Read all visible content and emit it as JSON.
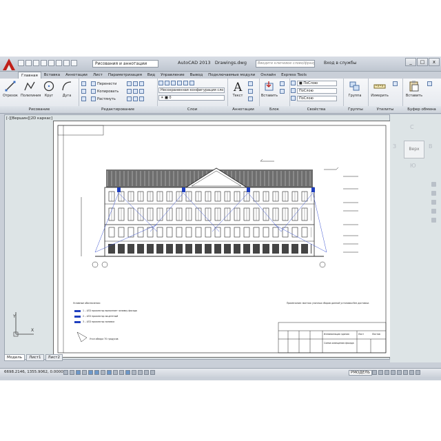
{
  "app": {
    "title": "AutoCAD 2013",
    "file": "Drawings.dwg",
    "workspace": "Рисования и аннотации",
    "search_placeholder": "Введите ключевое слово/фразу",
    "signin": "Вход в службы",
    "window_controls": [
      "_",
      "□",
      "x"
    ]
  },
  "ribbon": {
    "tabs": [
      "Главная",
      "Вставка",
      "Аннотации",
      "Лист",
      "Параметризация",
      "Вид",
      "Управление",
      "Вывод",
      "Подключаемые модули",
      "Онлайн",
      "Express Tools"
    ],
    "active_tab": "Главная",
    "draw": {
      "title": "Рисование",
      "tools": [
        "Отрезок",
        "Полилиния",
        "Круг",
        "Дуга"
      ]
    },
    "modify": {
      "title": "Редактирование",
      "tools": [
        "Перенести",
        "Копировать",
        "Растянуть"
      ]
    },
    "layers": {
      "title": "Слои",
      "layer_state": "Несохраненная конфигурация сло",
      "current_layer": "0"
    },
    "annotation": {
      "title": "Аннотации",
      "text": "Текст"
    },
    "block": {
      "title": "Блок",
      "insert": "Вставить"
    },
    "properties": {
      "title": "Свойства",
      "color": "ПоСлою",
      "linetype": "ПоСлою",
      "lineweight": "ПоСлою"
    },
    "groups": {
      "title": "Группы",
      "group": "Группа"
    },
    "utilities": {
      "title": "Утилиты",
      "measure": "Измерить"
    },
    "clipboard": {
      "title": "Буфер обмена",
      "paste": "Вставить"
    }
  },
  "viewport": {
    "label": "[-][Вершин][2D каркас]"
  },
  "viewcube": {
    "top": "Верх",
    "north": "С",
    "east": "В",
    "south": "Ю",
    "west": "З"
  },
  "drawing": {
    "legend_title": "Условные обозначения:",
    "legend": [
      "1 – LED прожектор выполняет заливку фасада",
      "2 – LED прожектор акцентный",
      "3 – LED прожектор заливка",
      "Угол обзора 70 градусов"
    ],
    "note": "Примечание: монтаж уличных сборов данной установки без доставки.",
    "stamp": [
      "Иллюминация здания",
      "Схема освещения фасада",
      "Лист",
      "Листов"
    ]
  },
  "model_tabs": [
    "Модель",
    "Лист1",
    "Лист2"
  ],
  "active_model_tab": "Модель",
  "status": {
    "coords": "6698.2146, 1355.9062, 0.0000",
    "model_label": "РМОДЕЛЬ"
  }
}
